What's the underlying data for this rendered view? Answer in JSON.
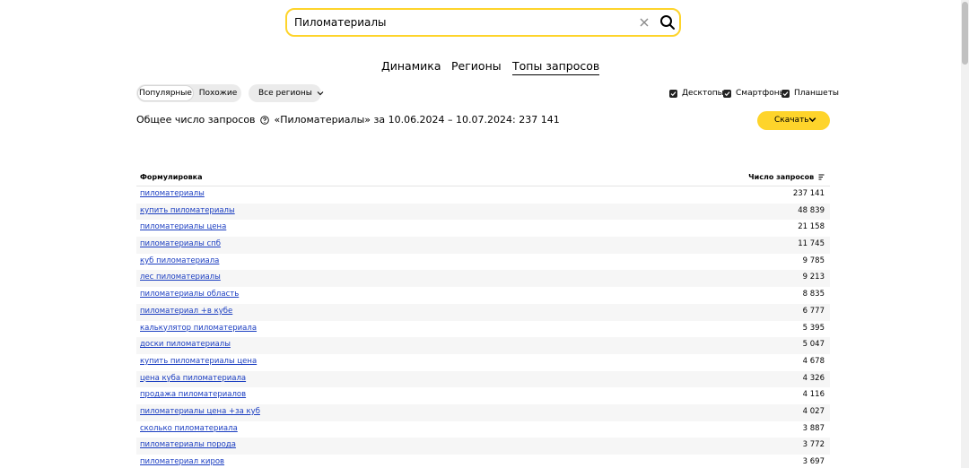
{
  "search": {
    "value": "Пиломатериалы"
  },
  "tabs": [
    {
      "label": "Динамика",
      "active": false
    },
    {
      "label": "Регионы",
      "active": false
    },
    {
      "label": "Топы запросов",
      "active": true
    }
  ],
  "filters": {
    "popular_label": "Популярные",
    "similar_label": "Похожие",
    "regions_label": "Все регионы"
  },
  "devices": [
    {
      "label": "Десктопы",
      "checked": true
    },
    {
      "label": "Смартфоны",
      "checked": true
    },
    {
      "label": "Планшеты",
      "checked": true
    }
  ],
  "summary": {
    "prefix": "Общее число запросов",
    "rest": "«Пиломатериалы» за 10.06.2024 – 10.07.2024: 237 141"
  },
  "download_label": "Скачать",
  "table": {
    "col_query": "Формулировка",
    "col_count": "Число запросов",
    "rows": [
      {
        "query": "пиломатериалы",
        "count": "237 141"
      },
      {
        "query": "купить пиломатериалы",
        "count": "48 839"
      },
      {
        "query": "пиломатериалы цена",
        "count": "21 158"
      },
      {
        "query": "пиломатериалы спб",
        "count": "11 745"
      },
      {
        "query": "куб пиломатериала",
        "count": "9 785"
      },
      {
        "query": "лес пиломатериалы",
        "count": "9 213"
      },
      {
        "query": "пиломатериалы область",
        "count": "8 835"
      },
      {
        "query": "пиломатериал +в кубе",
        "count": "6 777"
      },
      {
        "query": "калькулятор пиломатериала",
        "count": "5 395"
      },
      {
        "query": "доски пиломатериалы",
        "count": "5 047"
      },
      {
        "query": "купить пиломатериалы цена",
        "count": "4 678"
      },
      {
        "query": "цена куба пиломатериала",
        "count": "4 326"
      },
      {
        "query": "продажа пиломатериалов",
        "count": "4 116"
      },
      {
        "query": "пиломатериалы цена +за куб",
        "count": "4 027"
      },
      {
        "query": "сколько пиломатериала",
        "count": "3 887"
      },
      {
        "query": "пиломатериалы порода",
        "count": "3 772"
      },
      {
        "query": "пиломатериал киров",
        "count": "3 697"
      }
    ]
  }
}
